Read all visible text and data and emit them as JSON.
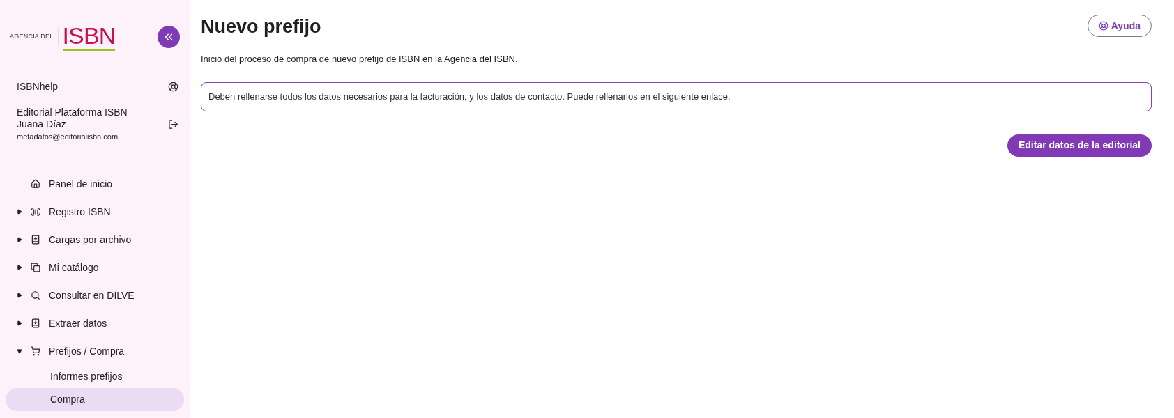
{
  "sidebar": {
    "logo": {
      "prefix": "AGENCIA DEL",
      "mark": "ISBN"
    },
    "help_link": "ISBNhelp",
    "user": {
      "publisher": "Editorial Plataforma ISBN",
      "name": "Juana Díaz",
      "email": "metadatos@editorialisbn.com"
    },
    "nav": [
      {
        "label": "Panel de inicio",
        "expandable": false,
        "expanded": false,
        "selected": false
      },
      {
        "label": "Registro ISBN",
        "expandable": true,
        "expanded": false,
        "selected": false
      },
      {
        "label": "Cargas por archivo",
        "expandable": true,
        "expanded": false,
        "selected": false
      },
      {
        "label": "Mi catálogo",
        "expandable": true,
        "expanded": false,
        "selected": false
      },
      {
        "label": "Consultar en DILVE",
        "expandable": true,
        "expanded": false,
        "selected": false
      },
      {
        "label": "Extraer datos",
        "expandable": true,
        "expanded": false,
        "selected": false
      },
      {
        "label": "Prefijos / Compra",
        "expandable": true,
        "expanded": true,
        "selected": false,
        "children": [
          {
            "label": "Informes prefijos",
            "selected": false
          },
          {
            "label": "Compra",
            "selected": true
          }
        ]
      }
    ]
  },
  "main": {
    "title": "Nuevo prefijo",
    "help_button": "Ayuda",
    "subtitle": "Inicio del proceso de compra de nuevo prefijo de ISBN en la Agencia del ISBN.",
    "notice": "Deben rellenarse todos los datos necesarios para la facturación, y los datos de contacto. Puede rellenarlos en el siguiente enlace.",
    "action_button": "Editar datos de la editorial"
  }
}
